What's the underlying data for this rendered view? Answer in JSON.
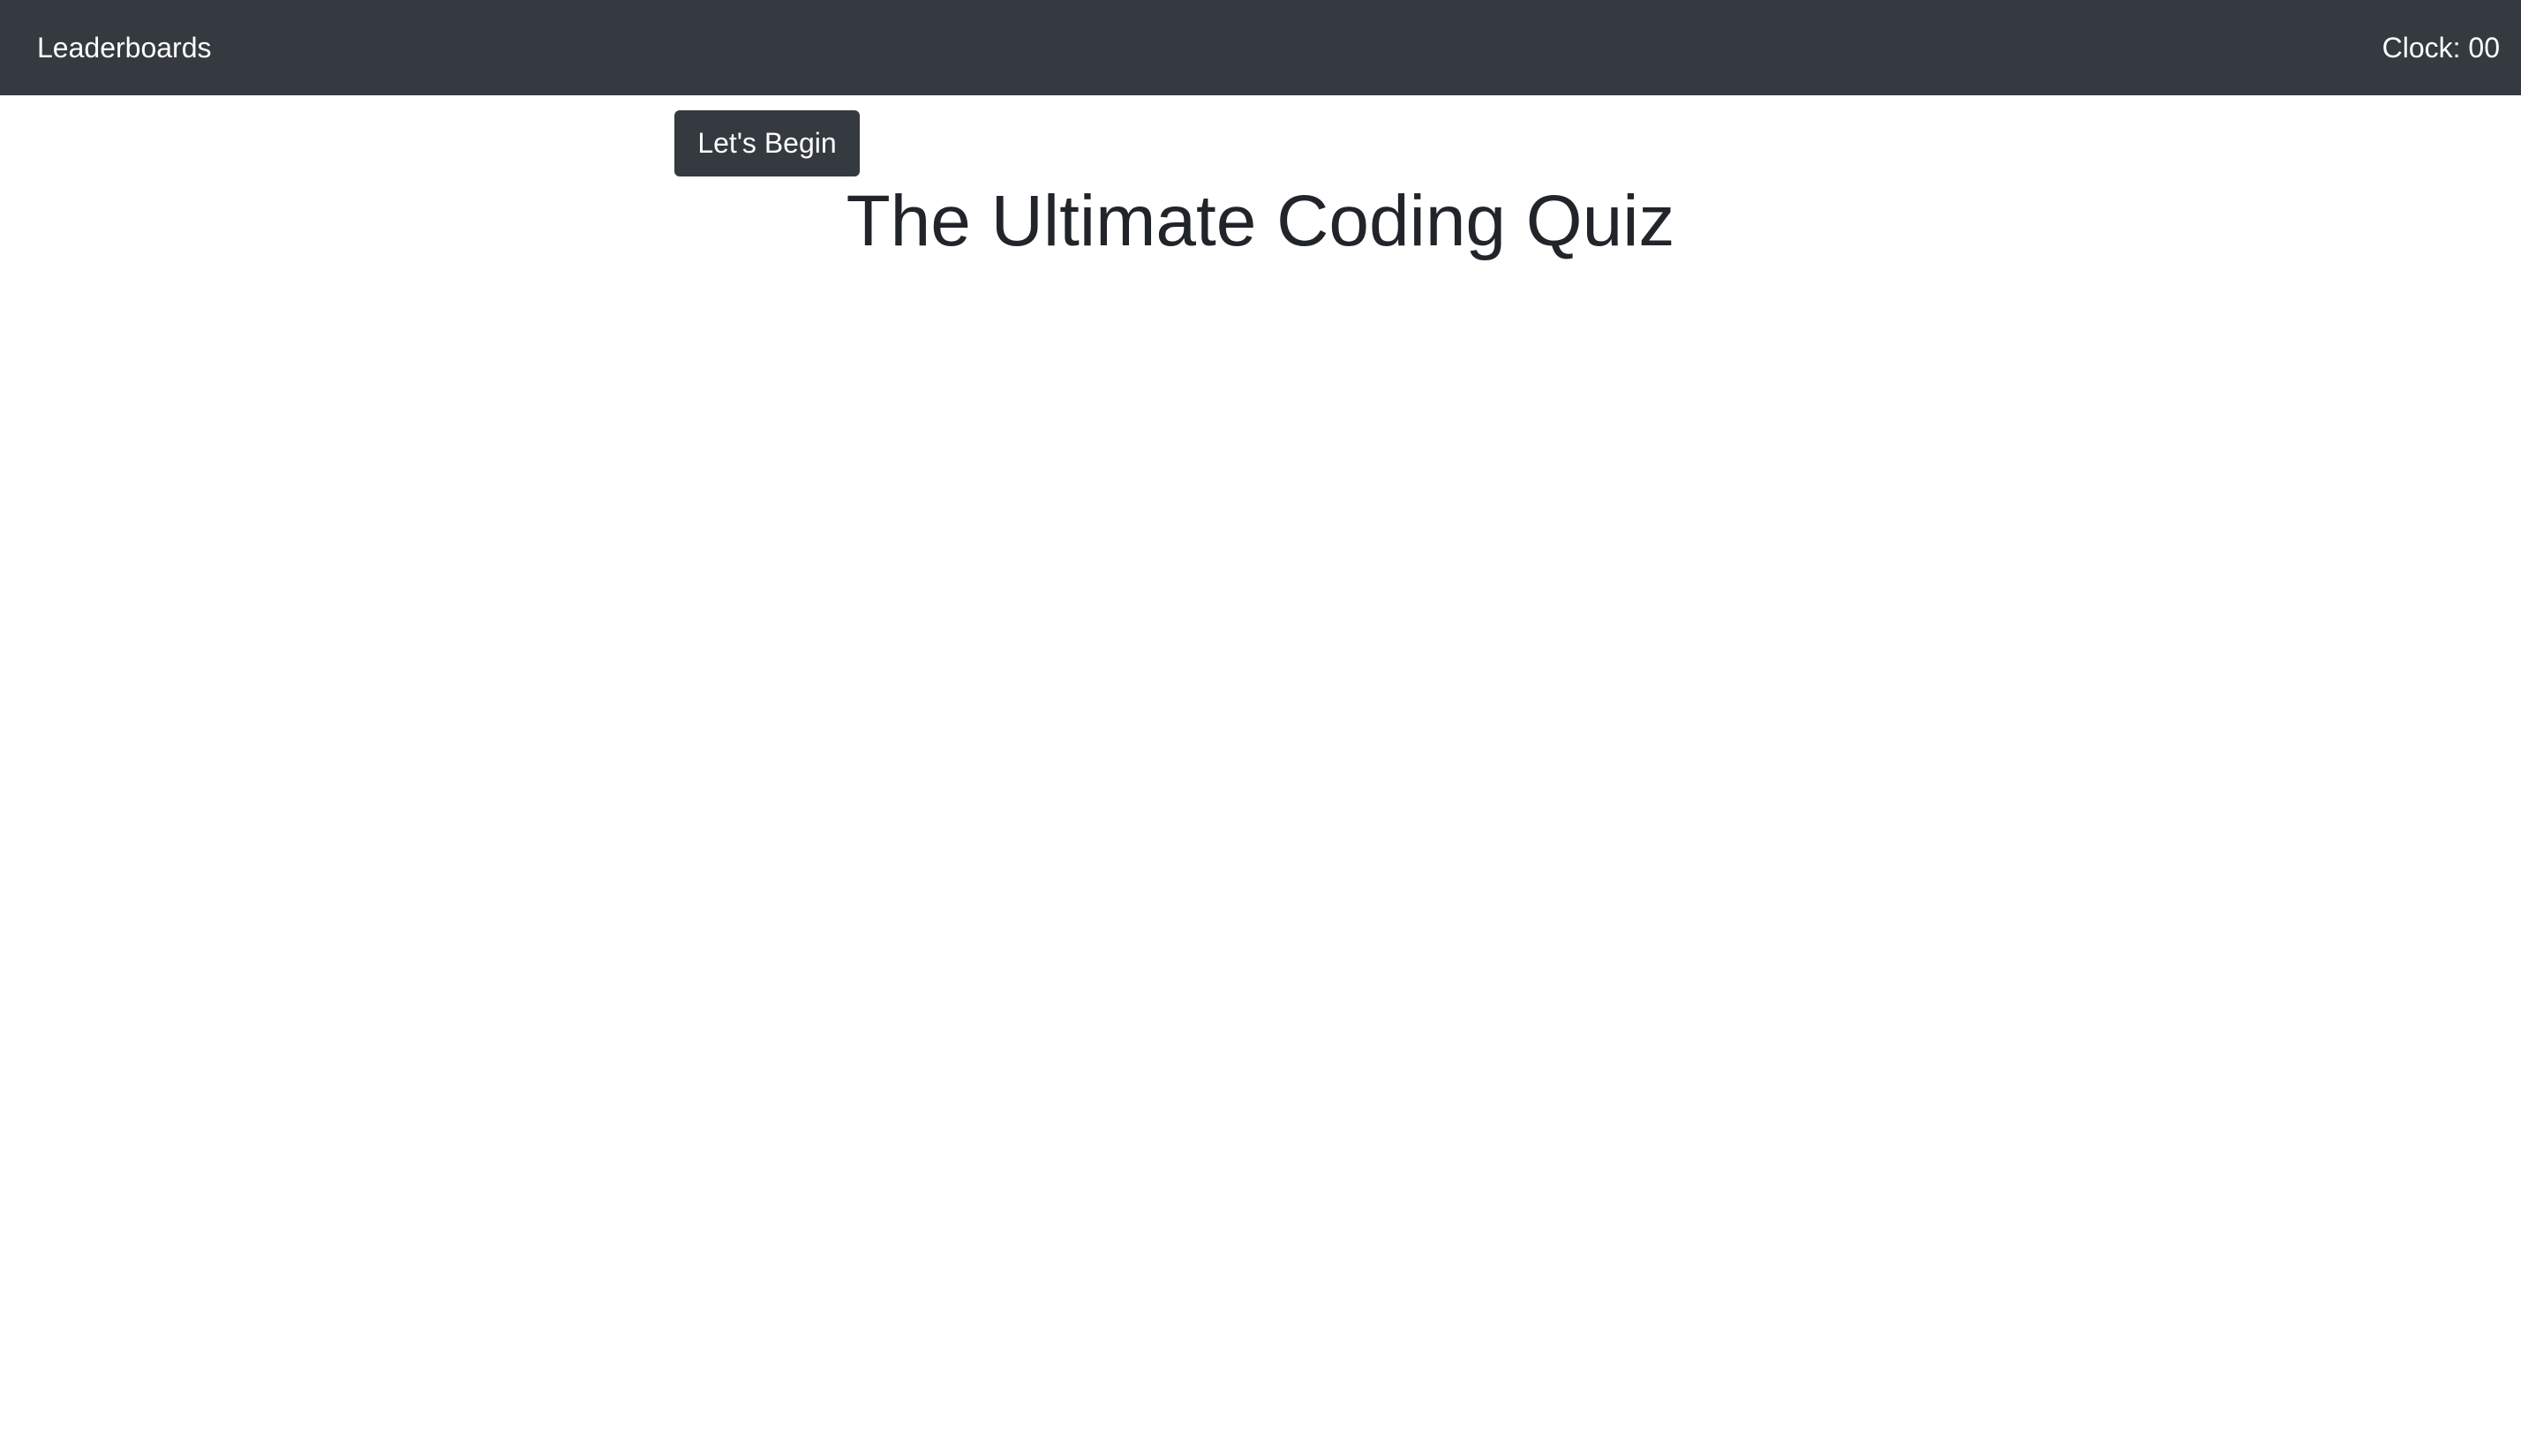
{
  "navbar": {
    "leaderboards_label": "Leaderboards",
    "clock_text": "Clock: 00",
    "background_color": "#343a40"
  },
  "main": {
    "begin_button_label": "Let's Begin",
    "title": "The Ultimate Coding Quiz"
  }
}
